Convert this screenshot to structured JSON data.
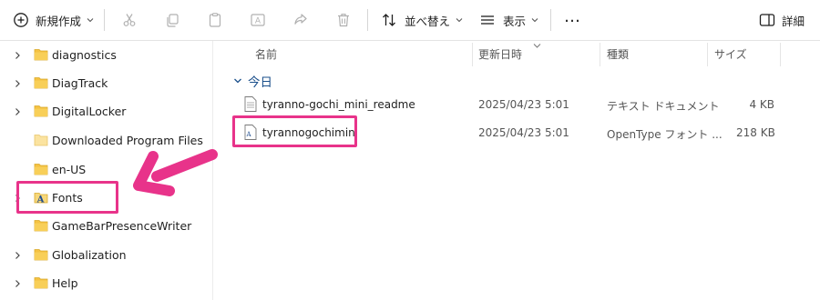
{
  "toolbar": {
    "new_label": "新規作成",
    "sort_label": "並べ替え",
    "view_label": "表示",
    "more_label": "…",
    "details_label": "詳細"
  },
  "sidebar": {
    "items": [
      {
        "label": "diagnostics",
        "expandable": true,
        "icon": "folder-icon"
      },
      {
        "label": "DiagTrack",
        "expandable": true,
        "icon": "folder-icon"
      },
      {
        "label": "DigitalLocker",
        "expandable": true,
        "icon": "folder-icon"
      },
      {
        "label": "Downloaded Program Files",
        "expandable": false,
        "icon": "folder-icon-light"
      },
      {
        "label": "en-US",
        "expandable": false,
        "icon": "folder-icon"
      },
      {
        "label": "Fonts",
        "expandable": true,
        "icon": "fonts-folder-icon"
      },
      {
        "label": "GameBarPresenceWriter",
        "expandable": false,
        "icon": "folder-icon"
      },
      {
        "label": "Globalization",
        "expandable": true,
        "icon": "folder-icon"
      },
      {
        "label": "Help",
        "expandable": true,
        "icon": "folder-icon"
      }
    ]
  },
  "columns": {
    "name": "名前",
    "modified": "更新日時",
    "type": "種類",
    "size": "サイズ"
  },
  "group": {
    "label": "今日"
  },
  "files": [
    {
      "name": "tyranno-gochi_mini_readme",
      "modified": "2025/04/23 5:01",
      "type": "テキスト ドキュメント",
      "size": "4 KB",
      "icon": "text-file-icon"
    },
    {
      "name": "tyrannogochimini",
      "modified": "2025/04/23 5:01",
      "type": "OpenType フォント ...",
      "size": "218 KB",
      "icon": "font-file-icon"
    }
  ],
  "colors": {
    "highlight": "#e8338a",
    "folder": "#f5c242",
    "group_header": "#1a4f8b"
  }
}
